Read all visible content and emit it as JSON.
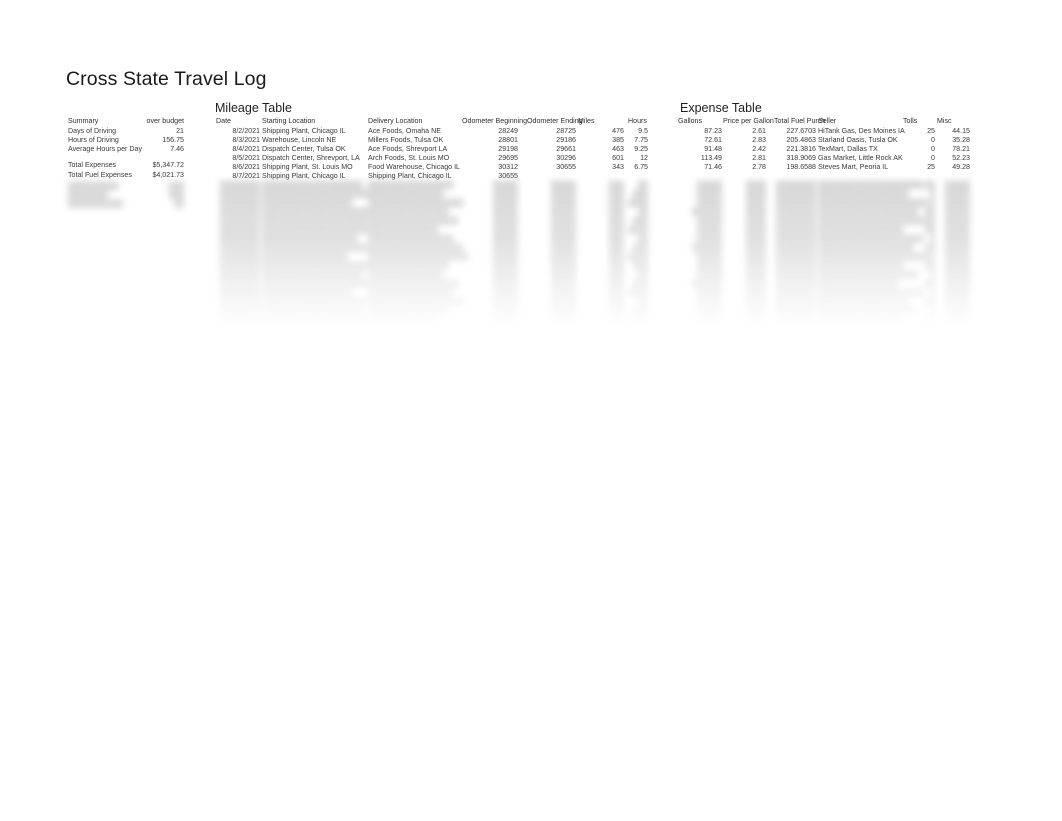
{
  "document": {
    "title": "Cross State Travel Log"
  },
  "summary": {
    "header": {
      "label": "Summary",
      "value": "over budget"
    },
    "rows": [
      {
        "label": "Days of Driving",
        "value": "21"
      },
      {
        "label": "Hours of Driving",
        "value": "156.75"
      },
      {
        "label": "Average Hours per Day",
        "value": "7.46"
      }
    ],
    "totals": [
      {
        "label": "Total Expenses",
        "value": "$5,347.72"
      },
      {
        "label": "Total Fuel Expenses",
        "value": "$4,021.73"
      }
    ]
  },
  "mileage_table": {
    "title": "Mileage Table",
    "columns": [
      "Date",
      "Starting Location",
      "Delivery Location",
      "Odometer Beginning",
      "Odometer Ending",
      "Miles",
      "Hours"
    ],
    "rows": [
      {
        "date": "8/2/2021",
        "starting_location": "Shipping Plant, Chicago IL",
        "delivery_location": "Ace Foods,  Omaha NE",
        "odometer_beginning": "28249",
        "odometer_ending": "28725",
        "miles": "476",
        "hours": "9.5"
      },
      {
        "date": "8/3/2021",
        "starting_location": "Warehouse, Lincoln NE",
        "delivery_location": "Millers Foods, Tulsa OK",
        "odometer_beginning": "28801",
        "odometer_ending": "29186",
        "miles": "385",
        "hours": "7.75"
      },
      {
        "date": "8/4/2021",
        "starting_location": "Dispatch Center, Tulsa OK",
        "delivery_location": "Ace Foods, Shrevport LA",
        "odometer_beginning": "29198",
        "odometer_ending": "29661",
        "miles": "463",
        "hours": "9.25"
      },
      {
        "date": "8/5/2021",
        "starting_location": "Dispatch Center, Shrevport, LA",
        "delivery_location": "Arch Foods, St. Louis MO",
        "odometer_beginning": "29695",
        "odometer_ending": "30296",
        "miles": "601",
        "hours": "12"
      },
      {
        "date": "8/6/2021",
        "starting_location": "Shipping Plant, St. Louis MO",
        "delivery_location": "Food Warehouse, Chicago IL",
        "odometer_beginning": "30312",
        "odometer_ending": "30655",
        "miles": "343",
        "hours": "6.75"
      },
      {
        "date": "8/7/2021",
        "starting_location": "Shipping Plant, Chicago IL",
        "delivery_location": "Shipping Plant, Chicago IL",
        "odometer_beginning": "30655",
        "odometer_ending": "",
        "miles": "",
        "hours": ""
      }
    ]
  },
  "expense_table": {
    "title": "Expense Table",
    "columns": [
      "Gallons",
      "Price per Gallon",
      "Total Fuel Purch",
      "Seller",
      "Tolls",
      "Misc"
    ],
    "rows": [
      {
        "gallons": "87.23",
        "price_per_gallon": "2.61",
        "total_fuel_purch": "227.6703",
        "seller": "HiTank Gas, Des Moines IA",
        "tolls": "25",
        "misc": "44.15"
      },
      {
        "gallons": "72.61",
        "price_per_gallon": "2.83",
        "total_fuel_purch": "205.4863",
        "seller": "Starland Oasis, Tusla OK",
        "tolls": "0",
        "misc": "35.28"
      },
      {
        "gallons": "91.48",
        "price_per_gallon": "2.42",
        "total_fuel_purch": "221.3816",
        "seller": "TexMart, Dallas TX",
        "tolls": "0",
        "misc": "78.21"
      },
      {
        "gallons": "113.49",
        "price_per_gallon": "2.81",
        "total_fuel_purch": "318.9069",
        "seller": "Gas Market, Little Rock AK",
        "tolls": "0",
        "misc": "52.23"
      },
      {
        "gallons": "71.46",
        "price_per_gallon": "2.78",
        "total_fuel_purch": "198.6588",
        "seller": "Steves Mart, Peoria IL",
        "tolls": "25",
        "misc": "49.28"
      }
    ]
  },
  "faded_region": {
    "note": "Additional rows continue below, rendered blurred and fading to blank",
    "summary_block": [
      "██████████",
      "████████",
      "███████████"
    ],
    "summary_values": [
      "███",
      "███",
      "██"
    ],
    "mileage_rows": [
      {
        "date": "████████",
        "starting_location": "████████████████████",
        "delivery_location": "█████████████████",
        "odometer_beginning": "█████",
        "odometer_ending": "█████",
        "miles": "███",
        "hours": "██"
      },
      {
        "date": "████████",
        "starting_location": "███████████████████████",
        "delivery_location": "███████████████",
        "odometer_beginning": "█████",
        "odometer_ending": "█████",
        "miles": "███",
        "hours": "███"
      },
      {
        "date": "████████",
        "starting_location": "██████████████████",
        "delivery_location": "███████████████████",
        "odometer_beginning": "█████",
        "odometer_ending": "█████",
        "miles": "███",
        "hours": "████"
      },
      {
        "date": "████████",
        "starting_location": "██████████████████████",
        "delivery_location": "████████████████",
        "odometer_beginning": "█████",
        "odometer_ending": "█████",
        "miles": "███",
        "hours": "██"
      },
      {
        "date": "████████",
        "starting_location": "█████████████████████",
        "delivery_location": "██████████████████",
        "odometer_beginning": "█████",
        "odometer_ending": "█████",
        "miles": "███",
        "hours": "███"
      },
      {
        "date": "████████",
        "starting_location": "████████████████████████",
        "delivery_location": "██████████████",
        "odometer_beginning": "█████",
        "odometer_ending": "█████",
        "miles": "███",
        "hours": "████"
      },
      {
        "date": "████████",
        "starting_location": "███████████████████",
        "delivery_location": "█████████████████",
        "odometer_beginning": "█████",
        "odometer_ending": "█████",
        "miles": "███",
        "hours": "██"
      },
      {
        "date": "████████",
        "starting_location": "█████████████████████",
        "delivery_location": "███████████████████",
        "odometer_beginning": "█████",
        "odometer_ending": "█████",
        "miles": "███",
        "hours": "███"
      },
      {
        "date": "████████",
        "starting_location": "█████████████████",
        "delivery_location": "████████████████████",
        "odometer_beginning": "█████",
        "odometer_ending": "█████",
        "miles": "███",
        "hours": "████"
      },
      {
        "date": "████████",
        "starting_location": "██████████████████████",
        "delivery_location": "████████████████",
        "odometer_beginning": "█████",
        "odometer_ending": "█████",
        "miles": "███",
        "hours": "███"
      },
      {
        "date": "████████",
        "starting_location": "████████████████████",
        "delivery_location": "███████████████",
        "odometer_beginning": "█████",
        "odometer_ending": "█████",
        "miles": "███",
        "hours": "██"
      },
      {
        "date": "████████",
        "starting_location": "███████████████████████",
        "delivery_location": "██████████████████",
        "odometer_beginning": "█████",
        "odometer_ending": "█████",
        "miles": "███",
        "hours": "███"
      },
      {
        "date": "████████",
        "starting_location": "██████████████████",
        "delivery_location": "█████████████████",
        "odometer_beginning": "█████",
        "odometer_ending": "█████",
        "miles": "███",
        "hours": "████"
      },
      {
        "date": "████████",
        "starting_location": "█████████████████████",
        "delivery_location": "███████████████████",
        "odometer_beginning": "█████",
        "odometer_ending": "█████",
        "miles": "███",
        "hours": "██"
      },
      {
        "date": "████████",
        "starting_location": "████████████████████",
        "delivery_location": "████████████████",
        "odometer_beginning": "█████",
        "odometer_ending": "█████",
        "miles": "███",
        "hours": "███"
      },
      {
        "date": "████████",
        "starting_location": "██████████████████████",
        "delivery_location": "██████████████",
        "odometer_beginning": "█████",
        "odometer_ending": "█████",
        "miles": "███",
        "hours": "████"
      }
    ],
    "expense_rows": [
      {
        "gallons": "█████",
        "price_per_gallon": "████",
        "total_fuel_purch": "████████",
        "seller": "█████████████████████",
        "tolls": "██",
        "misc": "█████"
      },
      {
        "gallons": "█████",
        "price_per_gallon": "████",
        "total_fuel_purch": "████████",
        "seller": "██████████████████",
        "tolls": "█",
        "misc": "█████"
      },
      {
        "gallons": "█████",
        "price_per_gallon": "████",
        "total_fuel_purch": "████████",
        "seller": "██████████████████████",
        "tolls": "█",
        "misc": "█████"
      },
      {
        "gallons": "██████",
        "price_per_gallon": "████",
        "total_fuel_purch": "████████",
        "seller": "████████████████████",
        "tolls": "██",
        "misc": "█████"
      },
      {
        "gallons": "█████",
        "price_per_gallon": "████",
        "total_fuel_purch": "████████",
        "seller": "███████████████████████",
        "tolls": "█",
        "misc": "█████"
      },
      {
        "gallons": "█████",
        "price_per_gallon": "████",
        "total_fuel_purch": "████████",
        "seller": "█████████████████",
        "tolls": "██",
        "misc": "█████"
      },
      {
        "gallons": "█████",
        "price_per_gallon": "████",
        "total_fuel_purch": "████████",
        "seller": "█████████████████████",
        "tolls": "█",
        "misc": "█████"
      },
      {
        "gallons": "██████",
        "price_per_gallon": "████",
        "total_fuel_purch": "████████",
        "seller": "███████████████████",
        "tolls": "██",
        "misc": "█████"
      },
      {
        "gallons": "█████",
        "price_per_gallon": "████",
        "total_fuel_purch": "████████",
        "seller": "██████████████████████",
        "tolls": "█",
        "misc": "█████"
      },
      {
        "gallons": "█████",
        "price_per_gallon": "████",
        "total_fuel_purch": "████████",
        "seller": "█████████████████",
        "tolls": "██",
        "misc": "█████"
      },
      {
        "gallons": "█████",
        "price_per_gallon": "████",
        "total_fuel_purch": "████████",
        "seller": "████████████████████",
        "tolls": "█",
        "misc": "█████"
      },
      {
        "gallons": "██████",
        "price_per_gallon": "████",
        "total_fuel_purch": "████████",
        "seller": "████████████████",
        "tolls": "██",
        "misc": "█████"
      },
      {
        "gallons": "█████",
        "price_per_gallon": "████",
        "total_fuel_purch": "████████",
        "seller": "█████████████████████",
        "tolls": "█",
        "misc": "█████"
      },
      {
        "gallons": "█████",
        "price_per_gallon": "████",
        "total_fuel_purch": "████████",
        "seller": "██████████████████",
        "tolls": "██",
        "misc": "█████"
      },
      {
        "gallons": "█████",
        "price_per_gallon": "████",
        "total_fuel_purch": "████████",
        "seller": "████████████████████",
        "tolls": "█",
        "misc": "█████"
      },
      {
        "gallons": "█████",
        "price_per_gallon": "████",
        "total_fuel_purch": "████████",
        "seller": "█████████████████",
        "tolls": "██",
        "misc": "█████"
      }
    ]
  }
}
